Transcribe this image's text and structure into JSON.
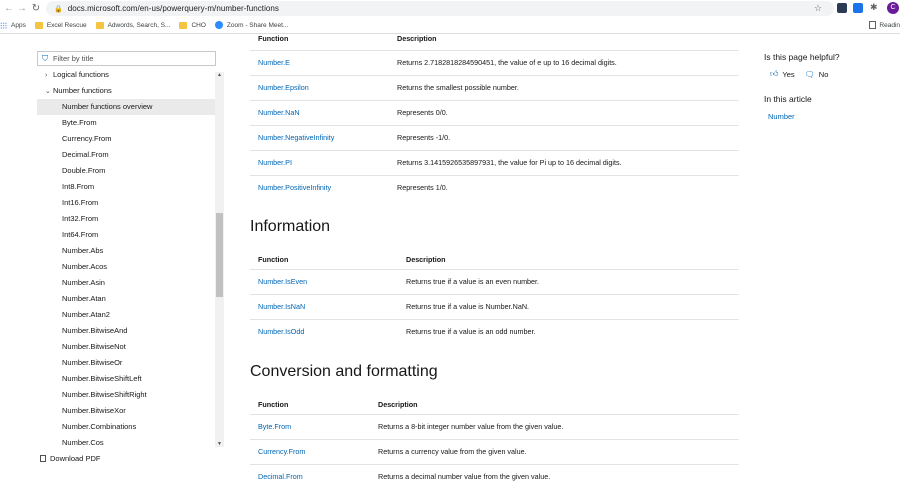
{
  "browser": {
    "url": "docs.microsoft.com/en-us/powerquery-m/number-functions",
    "avatar_letter": "C",
    "bookmarks": [
      "Apps",
      "Excel Rescue",
      "Adwords, Search, S...",
      "CHO",
      "Zoom - Share Meet..."
    ],
    "reading_list": "Readin"
  },
  "toc": {
    "filter_placeholder": "Filter by title",
    "items": [
      {
        "label": "Logical functions",
        "level": 1,
        "chevron": "›"
      },
      {
        "label": "Number functions",
        "level": 1,
        "chevron": "⌄"
      },
      {
        "label": "Number functions overview",
        "level": 2,
        "active": true
      },
      {
        "label": "Byte.From",
        "level": 2
      },
      {
        "label": "Currency.From",
        "level": 2
      },
      {
        "label": "Decimal.From",
        "level": 2
      },
      {
        "label": "Double.From",
        "level": 2
      },
      {
        "label": "Int8.From",
        "level": 2
      },
      {
        "label": "Int16.From",
        "level": 2
      },
      {
        "label": "Int32.From",
        "level": 2
      },
      {
        "label": "Int64.From",
        "level": 2
      },
      {
        "label": "Number.Abs",
        "level": 2
      },
      {
        "label": "Number.Acos",
        "level": 2
      },
      {
        "label": "Number.Asin",
        "level": 2
      },
      {
        "label": "Number.Atan",
        "level": 2
      },
      {
        "label": "Number.Atan2",
        "level": 2
      },
      {
        "label": "Number.BitwiseAnd",
        "level": 2
      },
      {
        "label": "Number.BitwiseNot",
        "level": 2
      },
      {
        "label": "Number.BitwiseOr",
        "level": 2
      },
      {
        "label": "Number.BitwiseShiftLeft",
        "level": 2
      },
      {
        "label": "Number.BitwiseShiftRight",
        "level": 2
      },
      {
        "label": "Number.BitwiseXor",
        "level": 2
      },
      {
        "label": "Number.Combinations",
        "level": 2
      },
      {
        "label": "Number.Cos",
        "level": 2
      }
    ],
    "download": "Download PDF"
  },
  "main": {
    "constants": {
      "headers": [
        "Function",
        "Description"
      ],
      "rows": [
        [
          "Number.E",
          "Returns 2.7182818284590451, the value of e up to 16 decimal digits."
        ],
        [
          "Number.Epsilon",
          "Returns the smallest possible number."
        ],
        [
          "Number.NaN",
          "Represents 0/0."
        ],
        [
          "Number.NegativeInfinity",
          "Represents -1/0."
        ],
        [
          "Number.PI",
          "Returns 3.1415926535897931, the value for Pi up to 16 decimal digits."
        ],
        [
          "Number.PositiveInfinity",
          "Represents 1/0."
        ]
      ]
    },
    "information": {
      "heading": "Information",
      "headers": [
        "Function",
        "Description"
      ],
      "rows": [
        [
          "Number.IsEven",
          "Returns true if a value is an even number."
        ],
        [
          "Number.IsNaN",
          "Returns true if a value is Number.NaN."
        ],
        [
          "Number.IsOdd",
          "Returns true if a value is an odd number."
        ]
      ]
    },
    "conversion": {
      "heading": "Conversion and formatting",
      "headers": [
        "Function",
        "Description"
      ],
      "rows": [
        [
          "Byte.From",
          "Returns a 8-bit integer number value from the given value."
        ],
        [
          "Currency.From",
          "Returns a currency value from the given value."
        ],
        [
          "Decimal.From",
          "Returns a decimal number value from the given value."
        ]
      ]
    }
  },
  "rail": {
    "helpful": "Is this page helpful?",
    "yes": "Yes",
    "no": "No",
    "in_article": "In this article",
    "links": [
      "Number"
    ]
  }
}
